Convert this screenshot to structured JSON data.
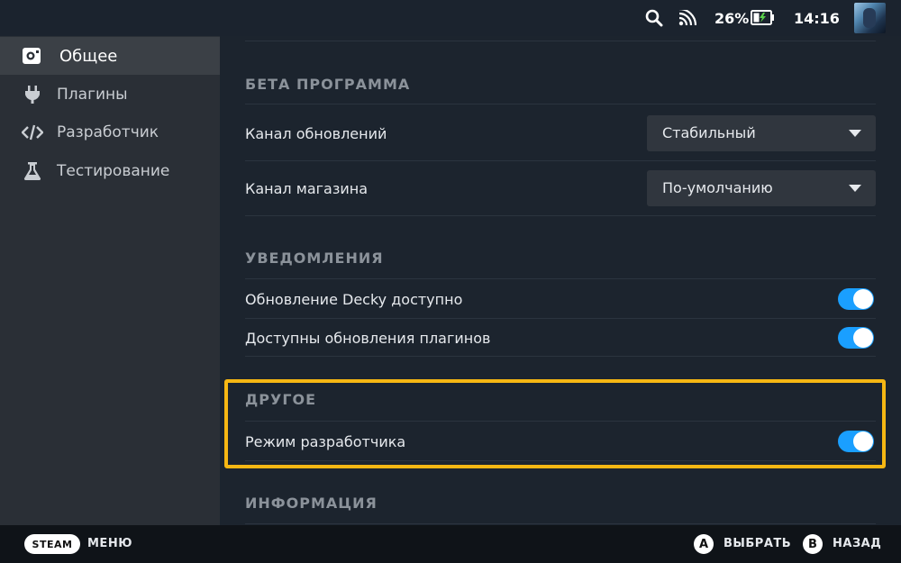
{
  "status_bar": {
    "icons": [
      "search-icon",
      "wifi-icon",
      "battery-charging-icon",
      "avatar"
    ],
    "battery": "26%",
    "time": "14:16"
  },
  "sidebar": {
    "items": [
      {
        "label": "Общее",
        "icon": "general-icon",
        "active": true
      },
      {
        "label": "Плагины",
        "icon": "plug-icon"
      },
      {
        "label": "Разработчик",
        "icon": "code-icon"
      },
      {
        "label": "Тестирование",
        "icon": "flask-icon"
      }
    ]
  },
  "main": {
    "beta": {
      "title": "БЕТА ПРОГРАММА",
      "update_channel_label": "Канал обновлений",
      "update_channel_value": "Стабильный",
      "store_channel_label": "Канал магазина",
      "store_channel_value": "По-умолчанию"
    },
    "notifications": {
      "title": "УВЕДОМЛЕНИЯ",
      "decky_update_label": "Обновление Decky доступно",
      "decky_update_enabled": true,
      "plugin_updates_label": "Доступны обновления плагинов",
      "plugin_updates_enabled": true
    },
    "other": {
      "title": "ДРУГОЕ",
      "dev_mode_label": "Режим разработчика",
      "dev_mode_enabled": true
    },
    "info": {
      "title": "ИНФОРМАЦИЯ"
    }
  },
  "bottom_bar": {
    "steam_label": "STEAM",
    "menu_label": "МЕНЮ",
    "a_glyph": "A",
    "select_label": "ВЫБРАТЬ",
    "b_glyph": "B",
    "back_label": "НАЗАД"
  },
  "colors": {
    "accent": "#1a9fff",
    "highlight": "#f6b713",
    "background": "#1c242e",
    "sidebar": "#2a2f36"
  }
}
